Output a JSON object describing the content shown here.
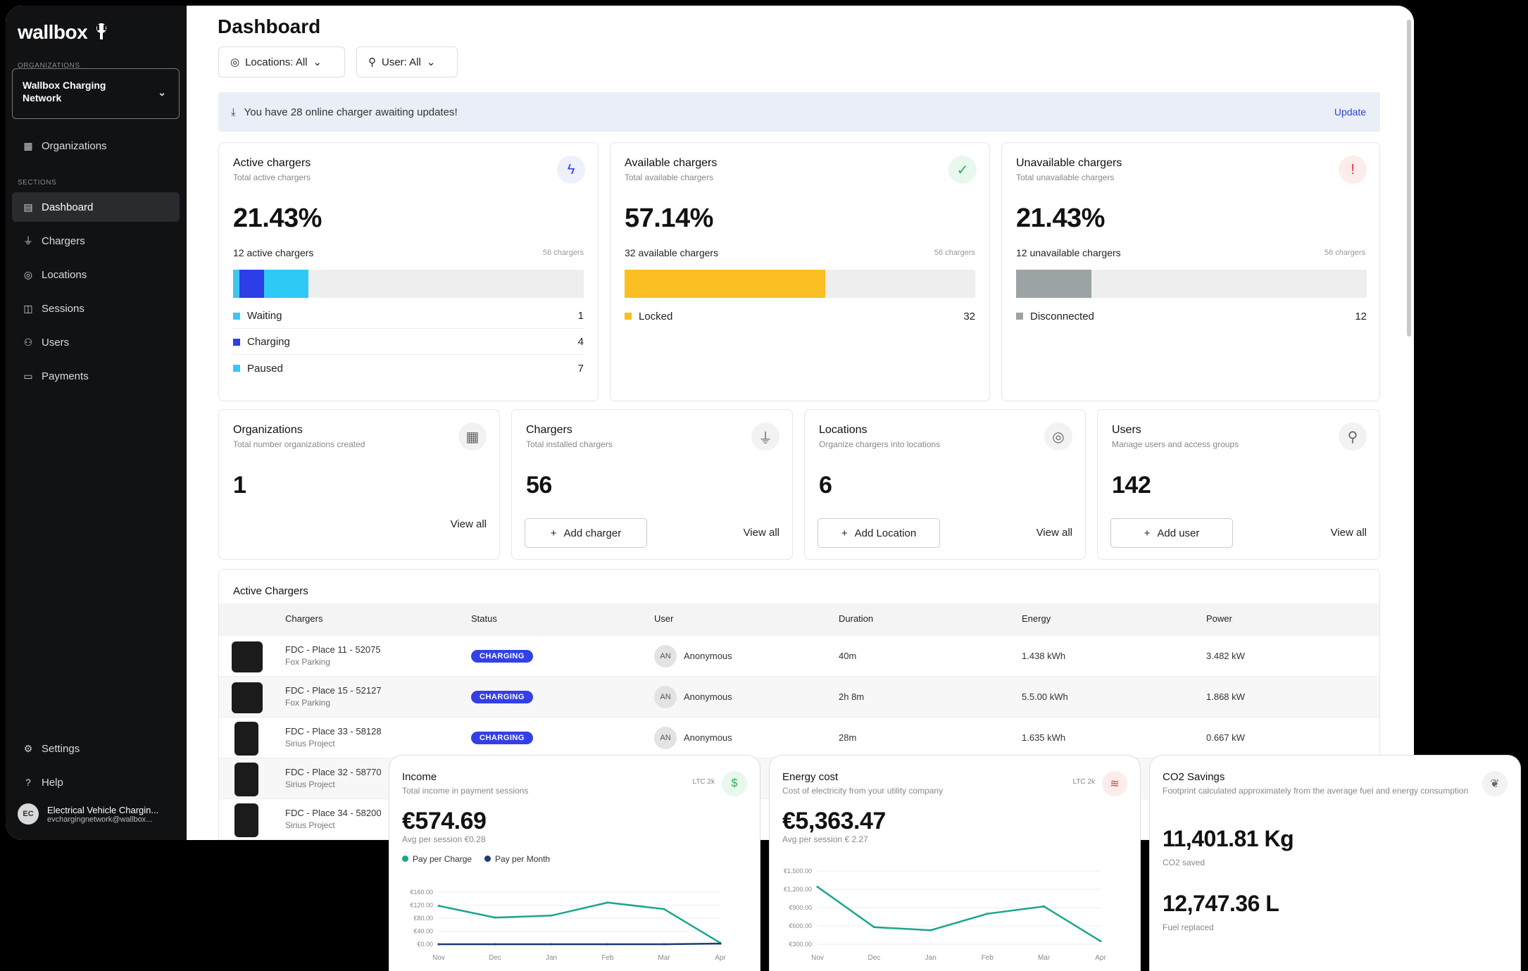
{
  "sidebar": {
    "logo": "wallbox",
    "org_caption": "ORGANIZATIONS",
    "org_name_line1": "Wallbox Charging",
    "org_name_line2": "Network",
    "organizations_label": "Organizations",
    "section_caption": "SECTIONS",
    "items": [
      {
        "label": "Dashboard",
        "icon": "dashboard-icon"
      },
      {
        "label": "Chargers",
        "icon": "plug-icon"
      },
      {
        "label": "Locations",
        "icon": "location-pin-icon"
      },
      {
        "label": "Sessions",
        "icon": "sessions-icon"
      },
      {
        "label": "Users",
        "icon": "users-icon"
      },
      {
        "label": "Payments",
        "icon": "card-icon"
      }
    ],
    "settings_label": "Settings",
    "help_label": "Help",
    "user": {
      "initials": "EC",
      "name": "Electrical Vehicle Chargin...",
      "email": "evchargingnetwork@wallbox..."
    }
  },
  "header": {
    "title": "Dashboard",
    "filter_locations": "Locations: All",
    "filter_user": "User: All"
  },
  "banner": {
    "text": "You have 28 online charger awaiting updates!",
    "action": "Update"
  },
  "status_cards": [
    {
      "title": "Active chargers",
      "subtitle": "Total active chargers",
      "value": "21.43%",
      "bar_label": "12 active chargers",
      "bar_total": "56 chargers",
      "icon": "bolt-icon",
      "legend": [
        {
          "label": "Waiting",
          "count": "1",
          "color": "#3ec6f0",
          "fraction": 0.0179
        },
        {
          "label": "Charging",
          "count": "4",
          "color": "#2d3ee8",
          "fraction": 0.0714
        },
        {
          "label": "Paused",
          "count": "7",
          "color": "#2fc9f5",
          "fraction": 0.125
        }
      ]
    },
    {
      "title": "Available chargers",
      "subtitle": "Total available chargers",
      "value": "57.14%",
      "bar_label": "32 available chargers",
      "bar_total": "56 chargers",
      "icon": "check-circle-icon",
      "legend": [
        {
          "label": "Locked",
          "count": "32",
          "color": "#fbbf24",
          "fraction": 0.5714
        }
      ]
    },
    {
      "title": "Unavailable chargers",
      "subtitle": "Total unavailable chargers",
      "value": "21.43%",
      "bar_label": "12 unavailable chargers",
      "bar_total": "56 chargers",
      "icon": "alert-circle-icon",
      "legend": [
        {
          "label": "Disconnected",
          "count": "12",
          "color": "#9ca3a5",
          "fraction": 0.2143
        }
      ]
    }
  ],
  "count_cards": [
    {
      "title": "Organizations",
      "subtitle": "Total number organizations created",
      "value": "1",
      "button": "",
      "view_all": "View all",
      "icon": "building-icon"
    },
    {
      "title": "Chargers",
      "subtitle": "Total installed chargers",
      "value": "56",
      "button": "Add charger",
      "view_all": "View all",
      "icon": "plug-icon"
    },
    {
      "title": "Locations",
      "subtitle": "Organize chargers into locations",
      "value": "6",
      "button": "Add Location",
      "view_all": "View all",
      "icon": "location-pin-icon"
    },
    {
      "title": "Users",
      "subtitle": "Manage users and access groups",
      "value": "142",
      "button": "Add user",
      "view_all": "View all",
      "icon": "user-icon"
    }
  ],
  "active_chargers": {
    "title": "Active Chargers",
    "columns": [
      "Chargers",
      "Status",
      "User",
      "Duration",
      "Energy",
      "Power"
    ],
    "rows": [
      {
        "name": "FDC - Place 11 - 52075",
        "location": "Fox Parking",
        "status": "CHARGING",
        "user": "Anonymous",
        "initials": "AN",
        "duration": "40m",
        "energy": "1.438 kWh",
        "power": "3.482 kW"
      },
      {
        "name": "FDC - Place 15 - 52127",
        "location": "Fox Parking",
        "status": "CHARGING",
        "user": "Anonymous",
        "initials": "AN",
        "duration": "2h 8m",
        "energy": "5.5.00 kWh",
        "power": "1.868 kW"
      },
      {
        "name": "FDC - Place 33 - 58128",
        "location": "Sirius Project",
        "status": "CHARGING",
        "user": "Anonymous",
        "initials": "AN",
        "duration": "28m",
        "energy": "1.635 kWh",
        "power": "0.667 kW"
      },
      {
        "name": "FDC - Place 32 - 58770",
        "location": "Sirius Project",
        "status": "",
        "user": "",
        "initials": "",
        "duration": "",
        "energy": "",
        "power": ""
      },
      {
        "name": "FDC - Place 34 - 58200",
        "location": "Sirius Project",
        "status": "",
        "user": "",
        "initials": "",
        "duration": "",
        "energy": "",
        "power": ""
      }
    ]
  },
  "income": {
    "title": "Income",
    "subtitle": "Total income in payment sessions",
    "date": "LTC 2k",
    "value": "€574.69",
    "avg": "Avg per session €0.28",
    "legend": [
      "Pay per Charge",
      "Pay per Month"
    ]
  },
  "energy_cost": {
    "title": "Energy cost",
    "subtitle": "Cost of electricity from your utility company",
    "date": "LTC 2k",
    "value": "€5,363.47",
    "avg": "Avg per session € 2.27"
  },
  "co2": {
    "title": "CO2 Savings",
    "subtitle": "Footprint calculated approximately from the average fuel and energy consumption",
    "kg_value": "11,401.81 Kg",
    "kg_label": "CO2 saved",
    "l_value": "12,747.36 L",
    "l_label": "Fuel replaced"
  },
  "chart_data": [
    {
      "type": "line",
      "title": "Income",
      "categories": [
        "Nov",
        "Dec",
        "Jan",
        "Feb",
        "Mar",
        "Apr"
      ],
      "yticks": [
        "€160.00",
        "€120.00",
        "€80.00",
        "€40.00",
        "€0.00"
      ],
      "ylim": [
        0,
        160
      ],
      "series": [
        {
          "name": "Pay per Charge",
          "color": "#1aa58d",
          "values": [
            118,
            82,
            88,
            128,
            108,
            4
          ]
        },
        {
          "name": "Pay per Month",
          "color": "#1f3a7a",
          "values": [
            0,
            0,
            0,
            0,
            0,
            2
          ]
        }
      ]
    },
    {
      "type": "line",
      "title": "Energy cost",
      "categories": [
        "Nov",
        "Dec",
        "Jan",
        "Feb",
        "Mar",
        "Apr"
      ],
      "yticks": [
        "€1,500.00",
        "€1,200.00",
        "€900.00",
        "€600.00",
        "€300.00"
      ],
      "ylim": [
        300,
        1500
      ],
      "series": [
        {
          "name": "",
          "color": "#1aa58d",
          "values": [
            1240,
            580,
            530,
            800,
            920,
            350
          ]
        }
      ]
    }
  ]
}
